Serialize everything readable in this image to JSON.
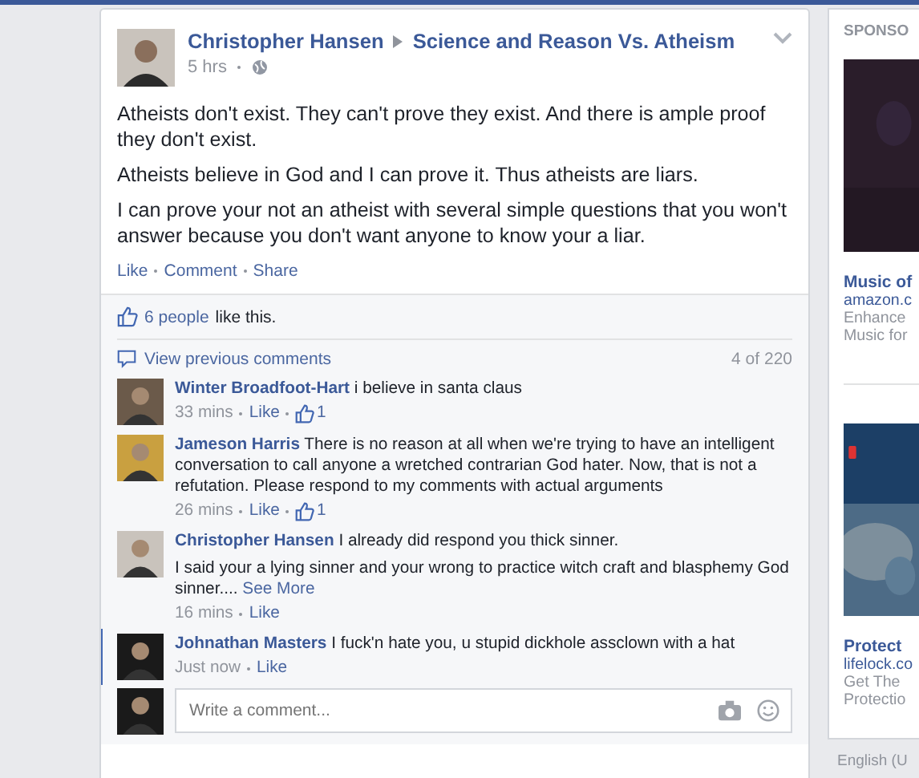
{
  "post": {
    "author": "Christopher Hansen",
    "group": "Science and Reason Vs. Atheism",
    "time": "5 hrs",
    "paragraphs": [
      "Atheists don't exist. They can't prove they exist. And there is ample proof they don't exist.",
      "Atheists believe in God and I can prove it. Thus atheists are liars.",
      "I can prove your not an atheist with several simple questions that you won't answer because you don't want anyone to know your a liar."
    ],
    "actions": [
      "Like",
      "Comment",
      "Share"
    ]
  },
  "likes": {
    "people": "6 people",
    "suffix": "like this."
  },
  "view_previous": "View previous comments",
  "count": "4 of 220",
  "comments": [
    {
      "author": "Winter Broadfoot-Hart",
      "text": "i believe in santa claus",
      "time": "33 mins",
      "like": "Like",
      "likes": "1",
      "unread": false
    },
    {
      "author": "Jameson Harris",
      "text": "There is no reason at all when we're trying to have an intelligent conversation to call anyone a wretched contrarian God hater. Now, that is not a refutation. Please respond to my comments with actual arguments",
      "time": "26 mins",
      "like": "Like",
      "likes": "1",
      "unread": false
    },
    {
      "author": "Christopher Hansen",
      "text": "I already did respond you thick sinner.",
      "extra": "I said your a lying sinner and your wrong to practice witch craft and blasphemy God sinner....",
      "more": "See More",
      "time": "16 mins",
      "like": "Like",
      "unread": false
    },
    {
      "author": "Johnathan Masters",
      "text": "I fuck'n hate you, u stupid dickhole assclown with a hat",
      "time": "Just now",
      "like": "Like",
      "unread": true
    }
  ],
  "composer": {
    "placeholder": "Write a comment..."
  },
  "sidebar": {
    "heading": "SPONSO",
    "ads": [
      {
        "title": "Music of",
        "domain": "amazon.c",
        "lines": [
          "Enhance",
          "Music for"
        ]
      },
      {
        "title": "Protect",
        "domain": "lifelock.co",
        "lines": [
          "Get The",
          "Protectio"
        ]
      }
    ],
    "footer": "English (U"
  }
}
